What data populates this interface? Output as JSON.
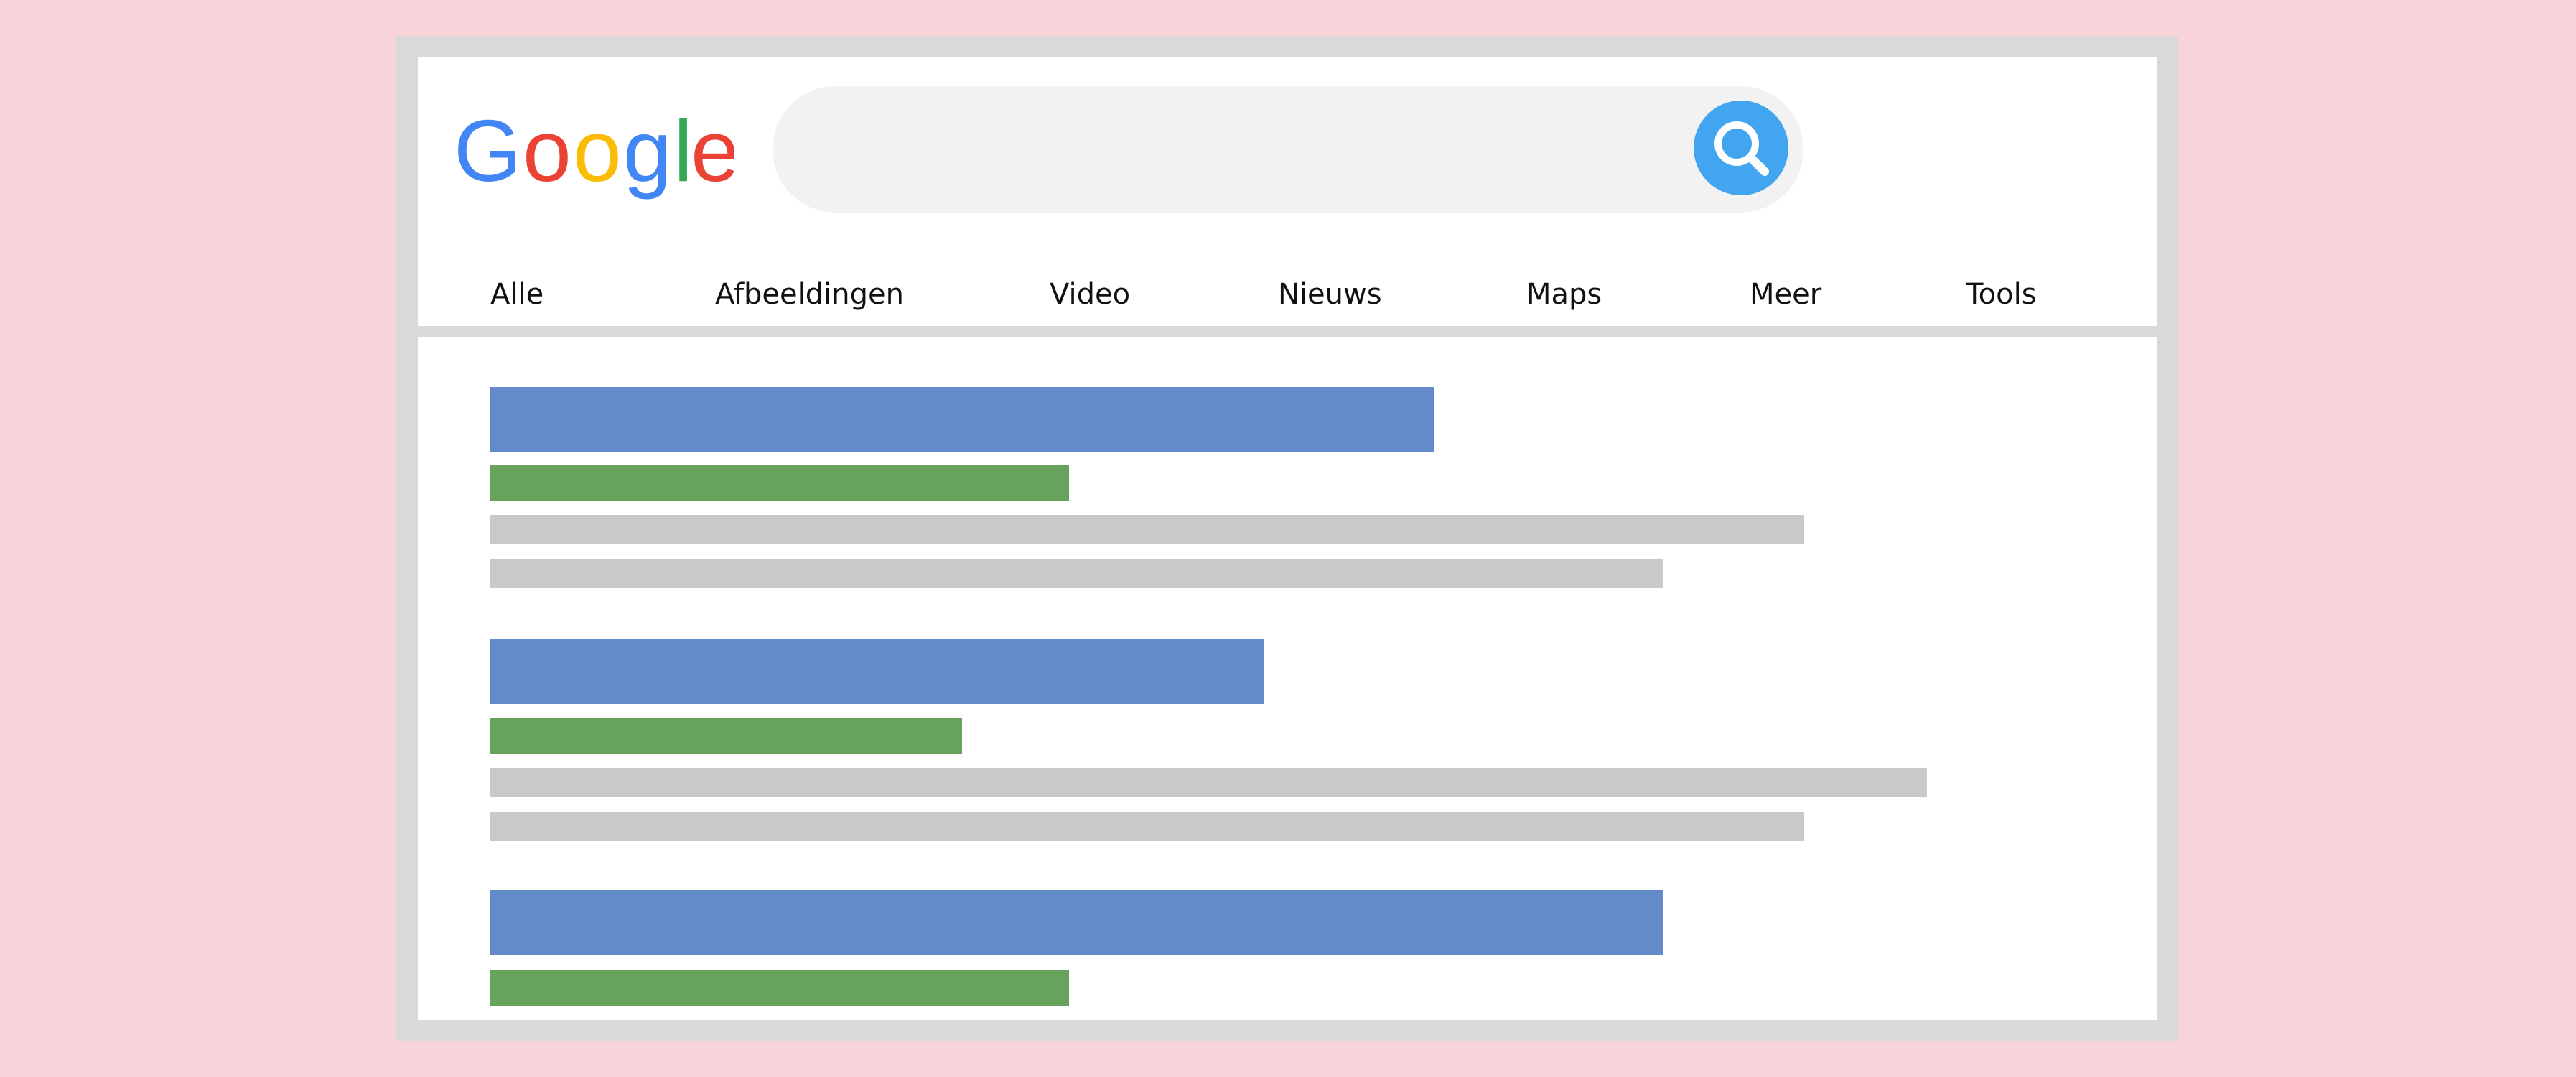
{
  "colors": {
    "background": "#f9d3da",
    "frame": "#d9d9d9",
    "search_bar": "#f2f2f2",
    "search_button": "#42a5f0",
    "result_title": "#648bc9",
    "result_url": "#67a35a",
    "result_snippet": "#c9c9c9",
    "logo_blue": "#4285f4",
    "logo_red": "#ea4335",
    "logo_yellow": "#fbbc05",
    "logo_green": "#34a853"
  },
  "logo": {
    "text": "Google"
  },
  "search": {
    "value": "",
    "placeholder": "",
    "button_icon": "search-icon"
  },
  "tabs": [
    {
      "label": "Alle"
    },
    {
      "label": "Afbeeldingen"
    },
    {
      "label": "Video"
    },
    {
      "label": "Nieuws"
    },
    {
      "label": "Maps"
    },
    {
      "label": "Meer"
    },
    {
      "label": "Tools"
    }
  ],
  "results": [
    {
      "title_bar": "placeholder",
      "url_bar": "placeholder",
      "snippet_lines": 2
    },
    {
      "title_bar": "placeholder",
      "url_bar": "placeholder",
      "snippet_lines": 2
    },
    {
      "title_bar": "placeholder",
      "url_bar": "placeholder",
      "snippet_lines": 0
    }
  ]
}
